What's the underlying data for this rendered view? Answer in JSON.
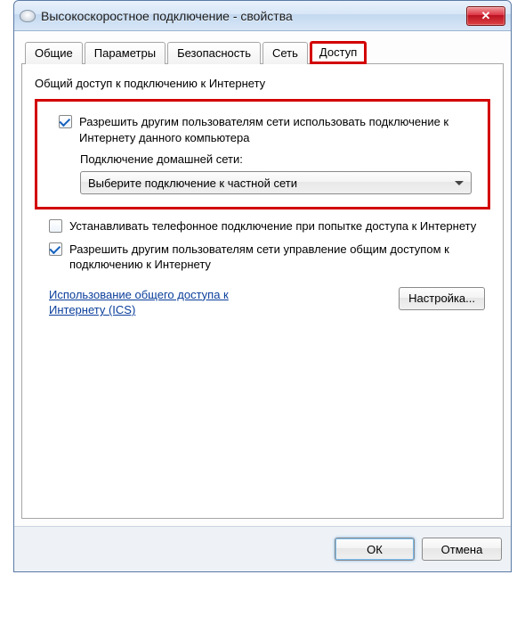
{
  "window": {
    "title": "Высокоскоростное подключение - свойства"
  },
  "tabs": {
    "general": "Общие",
    "parameters": "Параметры",
    "security": "Безопасность",
    "network": "Сеть",
    "access": "Доступ"
  },
  "content": {
    "group_title": "Общий доступ к подключению к Интернету",
    "allow_share_label": "Разрешить другим пользователям сети использовать подключение к Интернету данного компьютера",
    "home_network_label": "Подключение домашней сети:",
    "dropdown_value": "Выберите подключение к частной сети",
    "dial_label": "Устанавливать телефонное подключение при попытке доступа к Интернету",
    "allow_control_label": "Разрешить другим пользователям сети управление общим доступом к подключению к Интернету",
    "ics_link": "Использование общего доступа к Интернету (ICS)",
    "settings_button": "Настройка..."
  },
  "footer": {
    "ok": "ОК",
    "cancel": "Отмена"
  }
}
